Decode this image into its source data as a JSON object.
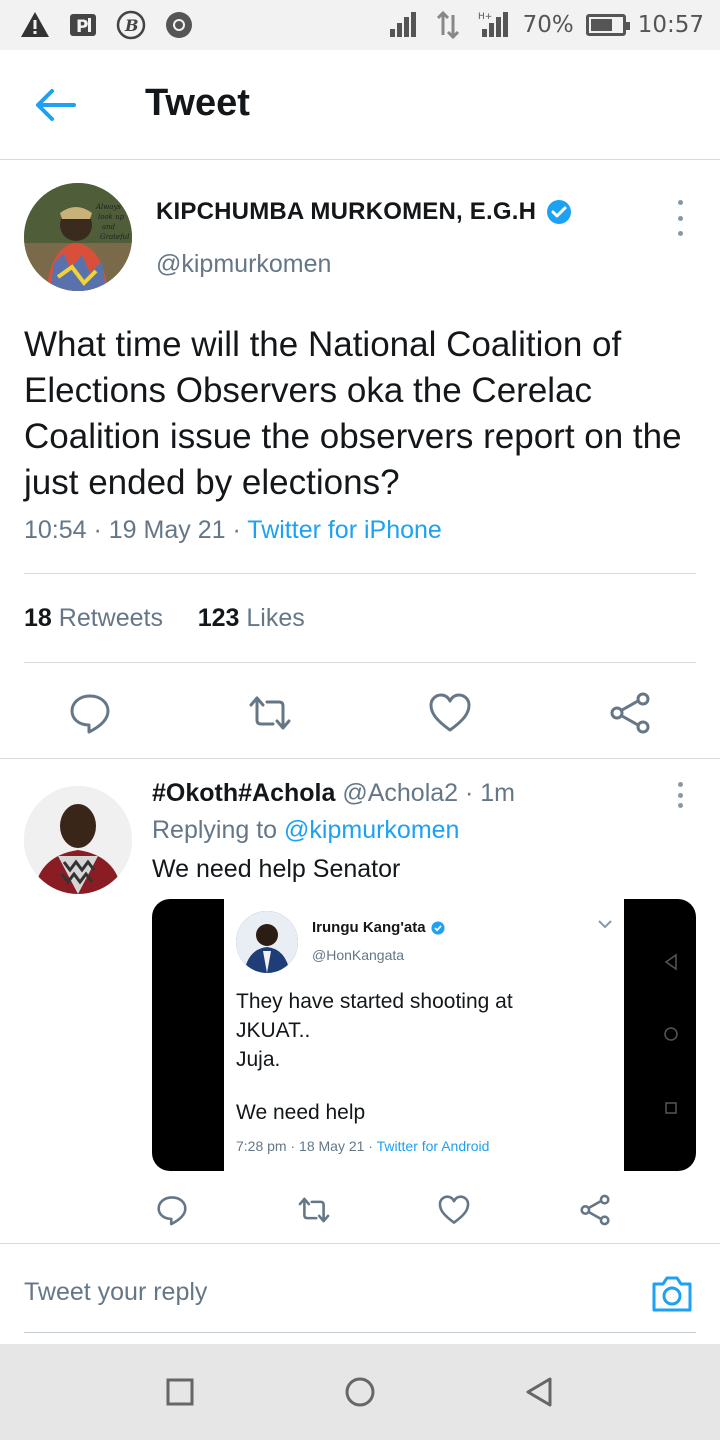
{
  "status_bar": {
    "battery": "70%",
    "time": "10:57",
    "battery_level": 0.7,
    "icons": [
      "warning-icon",
      "parking-app-icon",
      "b-app-icon",
      "chrome-icon",
      "signal-icon",
      "data-arrows-icon",
      "signal-h-plus-icon",
      "battery-icon"
    ]
  },
  "header": {
    "title": "Tweet",
    "back_icon": "arrow-left-icon"
  },
  "tweet": {
    "display_name": "KIPCHUMBA MURKOMEN, E.G.H",
    "handle": "@kipmurkomen",
    "text": "What time will the National Coalition of Elections Observers oka the Cerelac Coalition issue the observers report on the just ended by elections?",
    "time": "10:54",
    "date": "19 May 21",
    "source": "Twitter for iPhone",
    "retweets_count": "18",
    "retweets_label": "Retweets",
    "likes_count": "123",
    "likes_label": "Likes",
    "avatar_text": "Always look up and be Grateful"
  },
  "reply": {
    "display_name": "#Okoth#Achola",
    "handle": "@Achola2",
    "age": "1m",
    "replying_label": "Replying to",
    "replying_to": "@kipmurkomen",
    "text": "We need help Senator",
    "embedded": {
      "name": "Irungu Kang'ata",
      "handle": "@HonKangata",
      "text_line1": "They have started shooting at",
      "text_line2": "JKUAT..",
      "text_line3": "Juja.",
      "text_help": "We need help",
      "meta_time": "7:28 pm",
      "meta_date": "18 May 21",
      "meta_source": "Twitter for Android"
    }
  },
  "compose": {
    "placeholder": "Tweet your reply",
    "camera_icon": "camera-icon"
  },
  "colors": {
    "accent": "#1da1f2",
    "text": "#14171a",
    "muted": "#657786",
    "divider": "#d7dbdf"
  }
}
